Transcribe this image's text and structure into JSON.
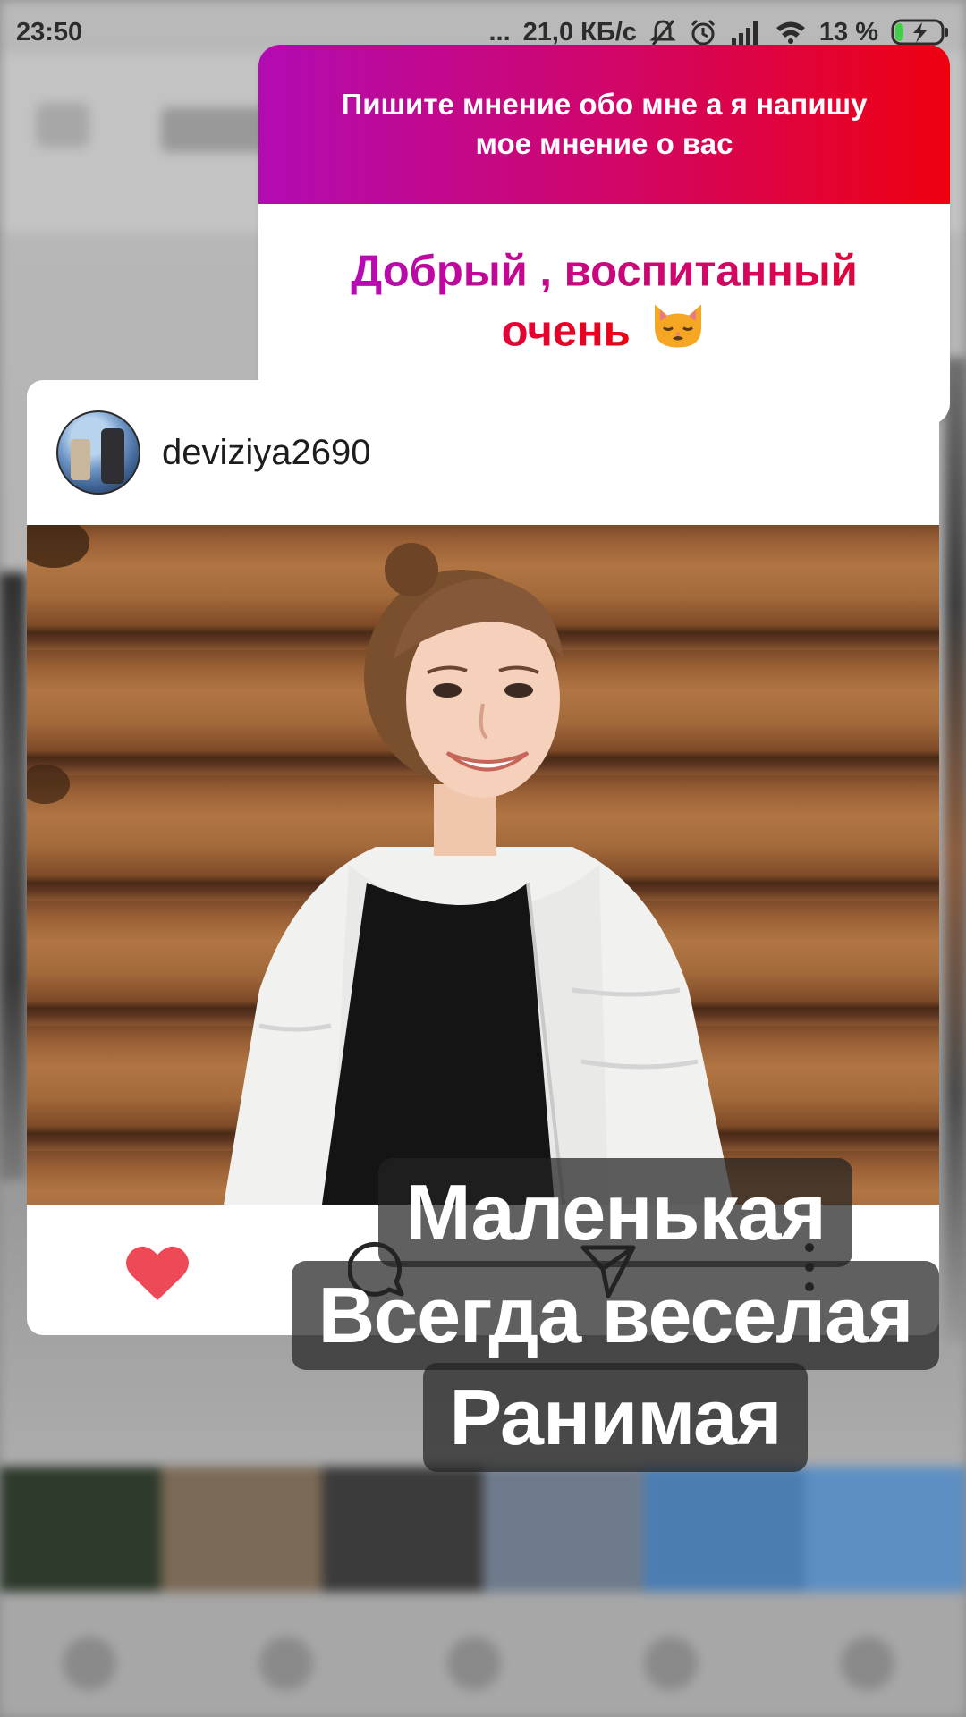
{
  "status_bar": {
    "time": "23:50",
    "dots": "...",
    "network_speed": "21,0 КБ/с",
    "battery": "13 %",
    "icons": [
      "mute-bell-icon",
      "alarm-icon",
      "signal-icon",
      "wifi-icon",
      "battery-charging-icon"
    ]
  },
  "question_sticker": {
    "question": "Пишите мнение обо мне а я напишу мое мнение о вас",
    "answer": "Добрый , воспитанный очень",
    "answer_emoji": "cat-face-icon",
    "colors": {
      "gradient_start": "#b20bb3",
      "gradient_end": "#ee0010"
    }
  },
  "post": {
    "username": "deviziya2690",
    "avatar": "avatar",
    "actions": [
      "heart-icon",
      "comment-icon",
      "share-icon",
      "more-icon"
    ],
    "liked": true,
    "like_color": "#ed4956"
  },
  "captions": {
    "line1": "Маленькая",
    "line2": "Всегда веселая",
    "line3": "Ранимая"
  }
}
